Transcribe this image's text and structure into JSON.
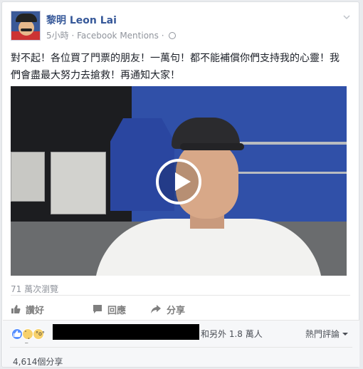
{
  "post": {
    "author": "黎明 Leon Lai",
    "time": "5小時",
    "separator1": "·",
    "source": "Facebook Mentions",
    "separator2": "·",
    "text": "對不起！各位買了門票的朋友！一萬句！都不能補償你們支持我的心靈！我們會盡最大努力去搶救！再通知大家！",
    "views": "71 萬次瀏覽"
  },
  "actions": {
    "like": "讚好",
    "comment": "回應",
    "share": "分享"
  },
  "reactions": {
    "others": "和另外 1.8 萬人",
    "sort": "熱門評論",
    "shares": "4,614個分享"
  },
  "colors": {
    "link": "#365899",
    "like_blue": "#5890ff",
    "muted": "#90949c"
  },
  "icons": [
    "globe-icon",
    "chevron-down-icon",
    "play-icon",
    "like-icon",
    "comment-icon",
    "share-icon",
    "sad-reaction-icon",
    "wow-reaction-icon"
  ]
}
